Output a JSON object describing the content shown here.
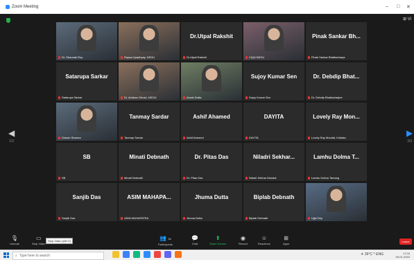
{
  "window": {
    "title": "Zoom Meeting",
    "minimize": "–",
    "maximize": "□",
    "close": "✕"
  },
  "view": {
    "label": "⊞ Vi"
  },
  "nav": {
    "left_label": "1/3",
    "right_label": "3/3"
  },
  "participants": [
    {
      "name": "",
      "caption": "Dr. Shaunak Roy",
      "video": true
    },
    {
      "name": "",
      "caption": "Rupsa Upadhyay, NSOU",
      "video": true
    },
    {
      "name": "Dr.Utpal Rakshit",
      "caption": "Dr.Utpal Rakshit",
      "video": false
    },
    {
      "name": "",
      "caption": "CIQA NSOU",
      "video": true
    },
    {
      "name": "Pinak Sankar Bh...",
      "caption": "Pinak Sankar Bhattacharya",
      "video": false
    },
    {
      "name": "Satarupa Sarkar",
      "caption": "Satarupa Sarkar",
      "video": false
    },
    {
      "name": "",
      "caption": "Dr. Anirban Ghosh, NSOU",
      "video": true,
      "active": true
    },
    {
      "name": "",
      "caption": "Arnab Dutta",
      "video": true
    },
    {
      "name": "Sujoy Kumar Sen",
      "caption": "Sujoy Kumar Sen",
      "video": false
    },
    {
      "name": "Dr. Debdip Bhat...",
      "caption": "Dr. Debdip Bhattacharjee",
      "video": false
    },
    {
      "name": "",
      "caption": "Dinesh Sharma",
      "video": true
    },
    {
      "name": "Tanmay Sardar",
      "caption": "Tanmay Sardar",
      "video": false
    },
    {
      "name": "Ashif Ahamed",
      "caption": "Ashif Ahamed",
      "video": false
    },
    {
      "name": "DAYITA",
      "caption": "DAYITA",
      "video": false
    },
    {
      "name": "Lovely Ray Mon...",
      "caption": "Lovely Ray Mondal, Kolkata",
      "video": false
    },
    {
      "name": "SB",
      "caption": "SB",
      "video": false
    },
    {
      "name": "Minati Debnath",
      "caption": "Minati Debnath",
      "video": false
    },
    {
      "name": "Dr. Pitas Das",
      "caption": "Dr. Pitas Das",
      "video": false
    },
    {
      "name": "Niladri Sekhar...",
      "caption": "Niladri Sekhar Mondal",
      "video": false
    },
    {
      "name": "Lamhu Dolma T...",
      "caption": "Lamhu Dolma Tamang",
      "video": false
    },
    {
      "name": "Sanjib Das",
      "caption": "Sanjib Das",
      "video": false
    },
    {
      "name": "ASIM MAHAPA...",
      "caption": "ASIM MAHAPATRA",
      "video": false
    },
    {
      "name": "Jhuma Dutta",
      "caption": "Jhuma Dutta",
      "video": false
    },
    {
      "name": "Biplab Debnath",
      "caption": "Biplab Debnath",
      "video": false
    },
    {
      "name": "",
      "caption": "Ujjal Dey",
      "video": true
    }
  ],
  "toolbar": {
    "unmute": "Unmute",
    "stop_video": "Stop Video",
    "tooltip": "Stop Video (Alt+V)",
    "participants": "Participants",
    "participants_count": "34",
    "chat": "Chat",
    "share": "Share Screen",
    "record": "Record",
    "reactions": "Reactions",
    "apps": "Apps",
    "leave": "Leave"
  },
  "taskbar": {
    "search_placeholder": "Type here to search",
    "weather": "26°C",
    "lang": "ENG",
    "time": "17:02",
    "date": "09-01-2022"
  }
}
